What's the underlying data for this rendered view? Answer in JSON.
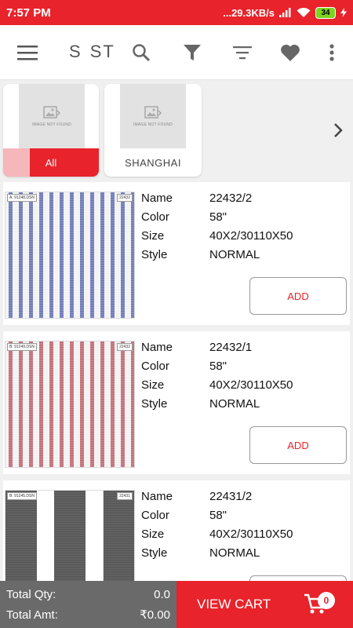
{
  "status_bar": {
    "time": "7:57 PM",
    "network_speed": "...29.3KB/s",
    "battery": "34",
    "icons": [
      "signal-icon",
      "wifi-icon",
      "battery-icon",
      "charging-icon"
    ]
  },
  "toolbar": {
    "title_part1": "S",
    "title_part2": "ST",
    "icons": [
      "menu-icon",
      "search-icon",
      "filter-icon",
      "sort-icon",
      "heart-icon",
      "more-vert-icon"
    ]
  },
  "categories": [
    {
      "label": "All",
      "image_text": "IMAGE NOT FOUND",
      "selected": true
    },
    {
      "label": "SHANGHAI",
      "image_text": "IMAGE NOT FOUND",
      "selected": false
    }
  ],
  "labels": {
    "name": "Name",
    "color": "Color",
    "size": "Size",
    "style": "Style",
    "add": "ADD"
  },
  "products": [
    {
      "name": "22432/2",
      "color": "58\"",
      "size": "40X2/30110X50",
      "style": "NORMAL",
      "tag_left": "A: 91248.DSN",
      "tag_right": "22432",
      "stripe_color": "#6b76b8"
    },
    {
      "name": "22432/1",
      "color": "58\"",
      "size": "40X2/30110X50",
      "style": "NORMAL",
      "tag_left": "B: 91249.DSN",
      "tag_right": "22432",
      "stripe_color": "#c06a74"
    },
    {
      "name": "22431/2",
      "color": "58\"",
      "size": "40X2/30110X50",
      "style": "NORMAL",
      "tag_left": "B: 91245.DSN",
      "tag_right": "22431",
      "stripe_color": "#555555"
    }
  ],
  "bottom": {
    "total_qty_label": "Total Qty:",
    "total_qty": "0.0",
    "total_amt_label": "Total Amt:",
    "total_amt": "₹0.00",
    "view_cart": "VIEW CART",
    "cart_count": "0"
  },
  "colors": {
    "accent": "#e8232b",
    "totals_bg": "#6a6a6a",
    "selected_tab_highlight": "#f6b7bb"
  }
}
